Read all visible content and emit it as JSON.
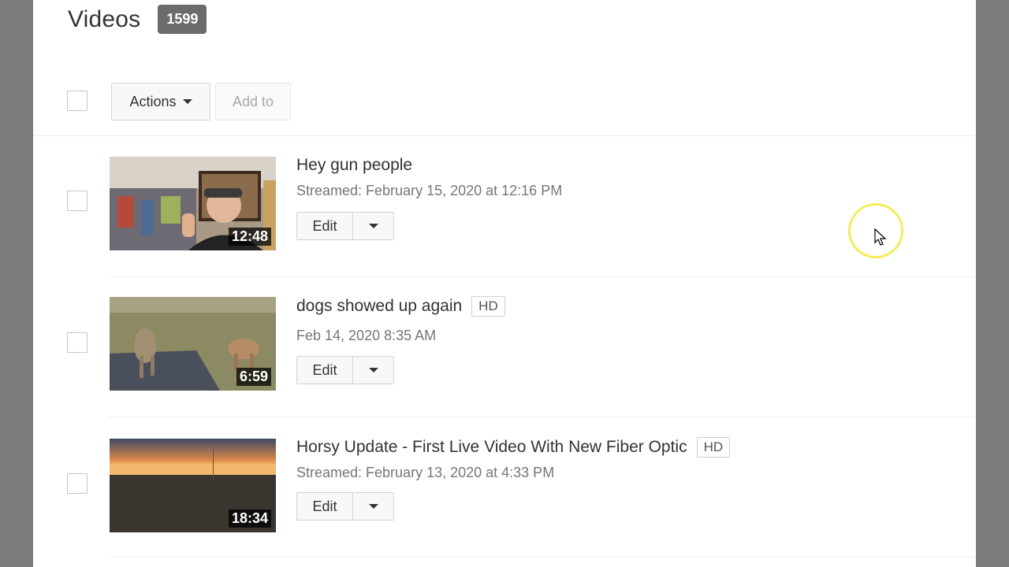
{
  "header": {
    "title": "Videos",
    "count": "1599"
  },
  "toolbar": {
    "actions_label": "Actions",
    "add_to_label": "Add to"
  },
  "videos": [
    {
      "title": "Hey gun people",
      "hd": "",
      "date": "Streamed: February 15, 2020 at 12:16 PM",
      "duration": "12:48",
      "edit_label": "Edit"
    },
    {
      "title": "dogs showed up again",
      "hd": "HD",
      "date": "Feb 14, 2020 8:35 AM",
      "duration": "6:59",
      "edit_label": "Edit"
    },
    {
      "title": "Horsy Update - First Live Video With New Fiber Optic",
      "hd": "HD",
      "date": "Streamed: February 13, 2020 at 4:33 PM",
      "duration": "18:34",
      "edit_label": "Edit"
    }
  ],
  "colors": {
    "side_background": "#7b7b7b",
    "badge": "#6b6b6b",
    "cursor_highlight": "#f3ec5a"
  },
  "icons": [
    "caret-down-icon",
    "mouse-cursor-icon"
  ]
}
